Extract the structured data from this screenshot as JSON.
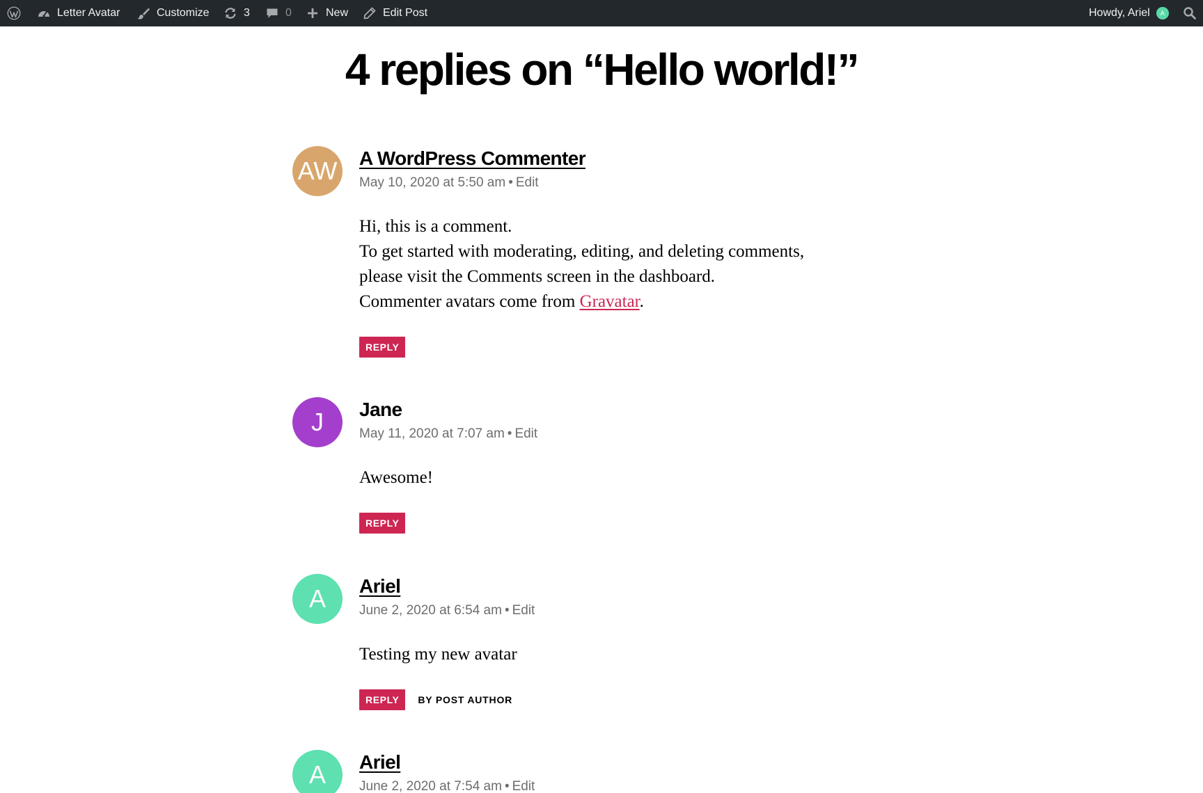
{
  "adminbar": {
    "site_name": "Letter Avatar",
    "customize": "Customize",
    "updates_count": "3",
    "comments_count": "0",
    "new_label": "New",
    "edit_post": "Edit Post",
    "howdy": "Howdy, Ariel",
    "user_initial": "A"
  },
  "comments": {
    "title": "4 replies on “Hello world!”",
    "edit_label": "Edit",
    "reply_label": "REPLY",
    "post_author_label": "BY POST AUTHOR",
    "items": [
      {
        "initials": "AW",
        "avatar_color": "#d8a66c",
        "author": "A WordPress Commenter",
        "date": "May 10, 2020 at 5:50 am",
        "lines": [
          "Hi, this is a comment.",
          "To get started with moderating, editing, and deleting comments,",
          "please visit the Comments screen in the dashboard."
        ],
        "last_line_prefix": "Commenter avatars come from ",
        "link_text": "Gravatar",
        "last_line_suffix": "."
      },
      {
        "initials": "J",
        "avatar_color": "#a43ecc",
        "author": "Jane",
        "date": "May 11, 2020 at 7:07 am",
        "text": "Awesome!"
      },
      {
        "initials": "A",
        "avatar_color": "#5ee0b0",
        "author": "Ariel",
        "date": "June 2, 2020 at 6:54 am",
        "text": "Testing my new avatar"
      },
      {
        "initials": "A",
        "avatar_color": "#5ee0b0",
        "author": "Ariel",
        "date": "June 2, 2020 at 7:54 am"
      }
    ]
  },
  "colors": {
    "accent": "#cd2653",
    "adminbar_bg": "#23282d",
    "meta_text": "#6d6d6d"
  }
}
